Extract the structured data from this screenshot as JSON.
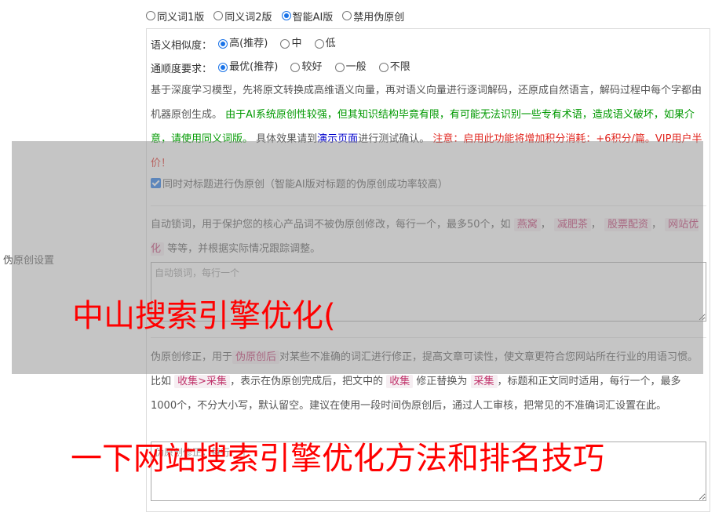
{
  "mode_options": [
    {
      "label": "同义词1版",
      "selected": false
    },
    {
      "label": "同义词2版",
      "selected": false
    },
    {
      "label": "智能AI版",
      "selected": true
    },
    {
      "label": "禁用伪原创",
      "selected": false
    }
  ],
  "side_label": "伪原创设置",
  "similarity": {
    "label": "语义相似度：",
    "options": [
      {
        "label": "高(推荐)",
        "selected": true
      },
      {
        "label": "中",
        "selected": false
      },
      {
        "label": "低",
        "selected": false
      }
    ]
  },
  "fluency": {
    "label": "通顺度要求：",
    "options": [
      {
        "label": "最优(推荐)",
        "selected": true
      },
      {
        "label": "较好",
        "selected": false
      },
      {
        "label": "一般",
        "selected": false
      },
      {
        "label": "不限",
        "selected": false
      }
    ]
  },
  "description": {
    "part1": "基于深度学习模型，先将原文转换成高维语义向量，再对语义向量进行逐词解码，还原成自然语言，解码过程中每个字都由机器原创生成。",
    "part2_green": "由于AI系统原创性较强，但其知识结构毕竟有限，有可能无法识别一些专有术语，造成语义破坏，如果介意，请使用同义词版。",
    "part3": "具体效果请到",
    "link": "演示页面",
    "part4": "进行测试确认。",
    "part5_red": "注意：启用此功能将增加积分消耗：+6积分/篇。VIP用户半价！"
  },
  "title_checkbox": {
    "checked": true,
    "label": "同时对标题进行伪原创（智能AI版对标题的伪原创成功率较高）"
  },
  "lock_words": {
    "text_before": "自动锁词，用于保护您的核心产品词不被伪原创修改，每行一个，最多50个，如",
    "tags": [
      "燕窝",
      "减肥茶",
      "股票配资",
      "网站优化"
    ],
    "text_after": "等等，并根据实际情况跟踪调整。",
    "placeholder": "自动锁词，每行一个"
  },
  "correction": {
    "text1": "伪原创修正，用于",
    "tag1": "伪原创后",
    "text2": "对某些不准确的词汇进行修正，提高文章可读性，使文章更符合您网站所在行业的用语习惯。比如",
    "tag2": "收集>采集",
    "text3": "，表示在伪原创完成后，把文中的",
    "tag3": "收集",
    "text4": "修正替换为",
    "tag4": "采集",
    "text5": "，标题和正文同时适用，每行一个，最多1000个，不分大小写，默认留空。建议在使用一段时间伪原创后，通过人工审核，把常见的不准确词汇设置在此。",
    "placeholder": "伪原创修正，每行一个"
  },
  "watermarks": [
    "中山搜索引擎优化(",
    "一下网站搜索引擎优化方法和排名技巧"
  ],
  "colors": {
    "accent": "#1a73e8",
    "green_text": "#009900",
    "red_text": "#e0241d",
    "link": "#0000cc",
    "tag_text": "#c0326a",
    "tag_bg": "#f6eef2",
    "watermark": "#ff0000"
  }
}
